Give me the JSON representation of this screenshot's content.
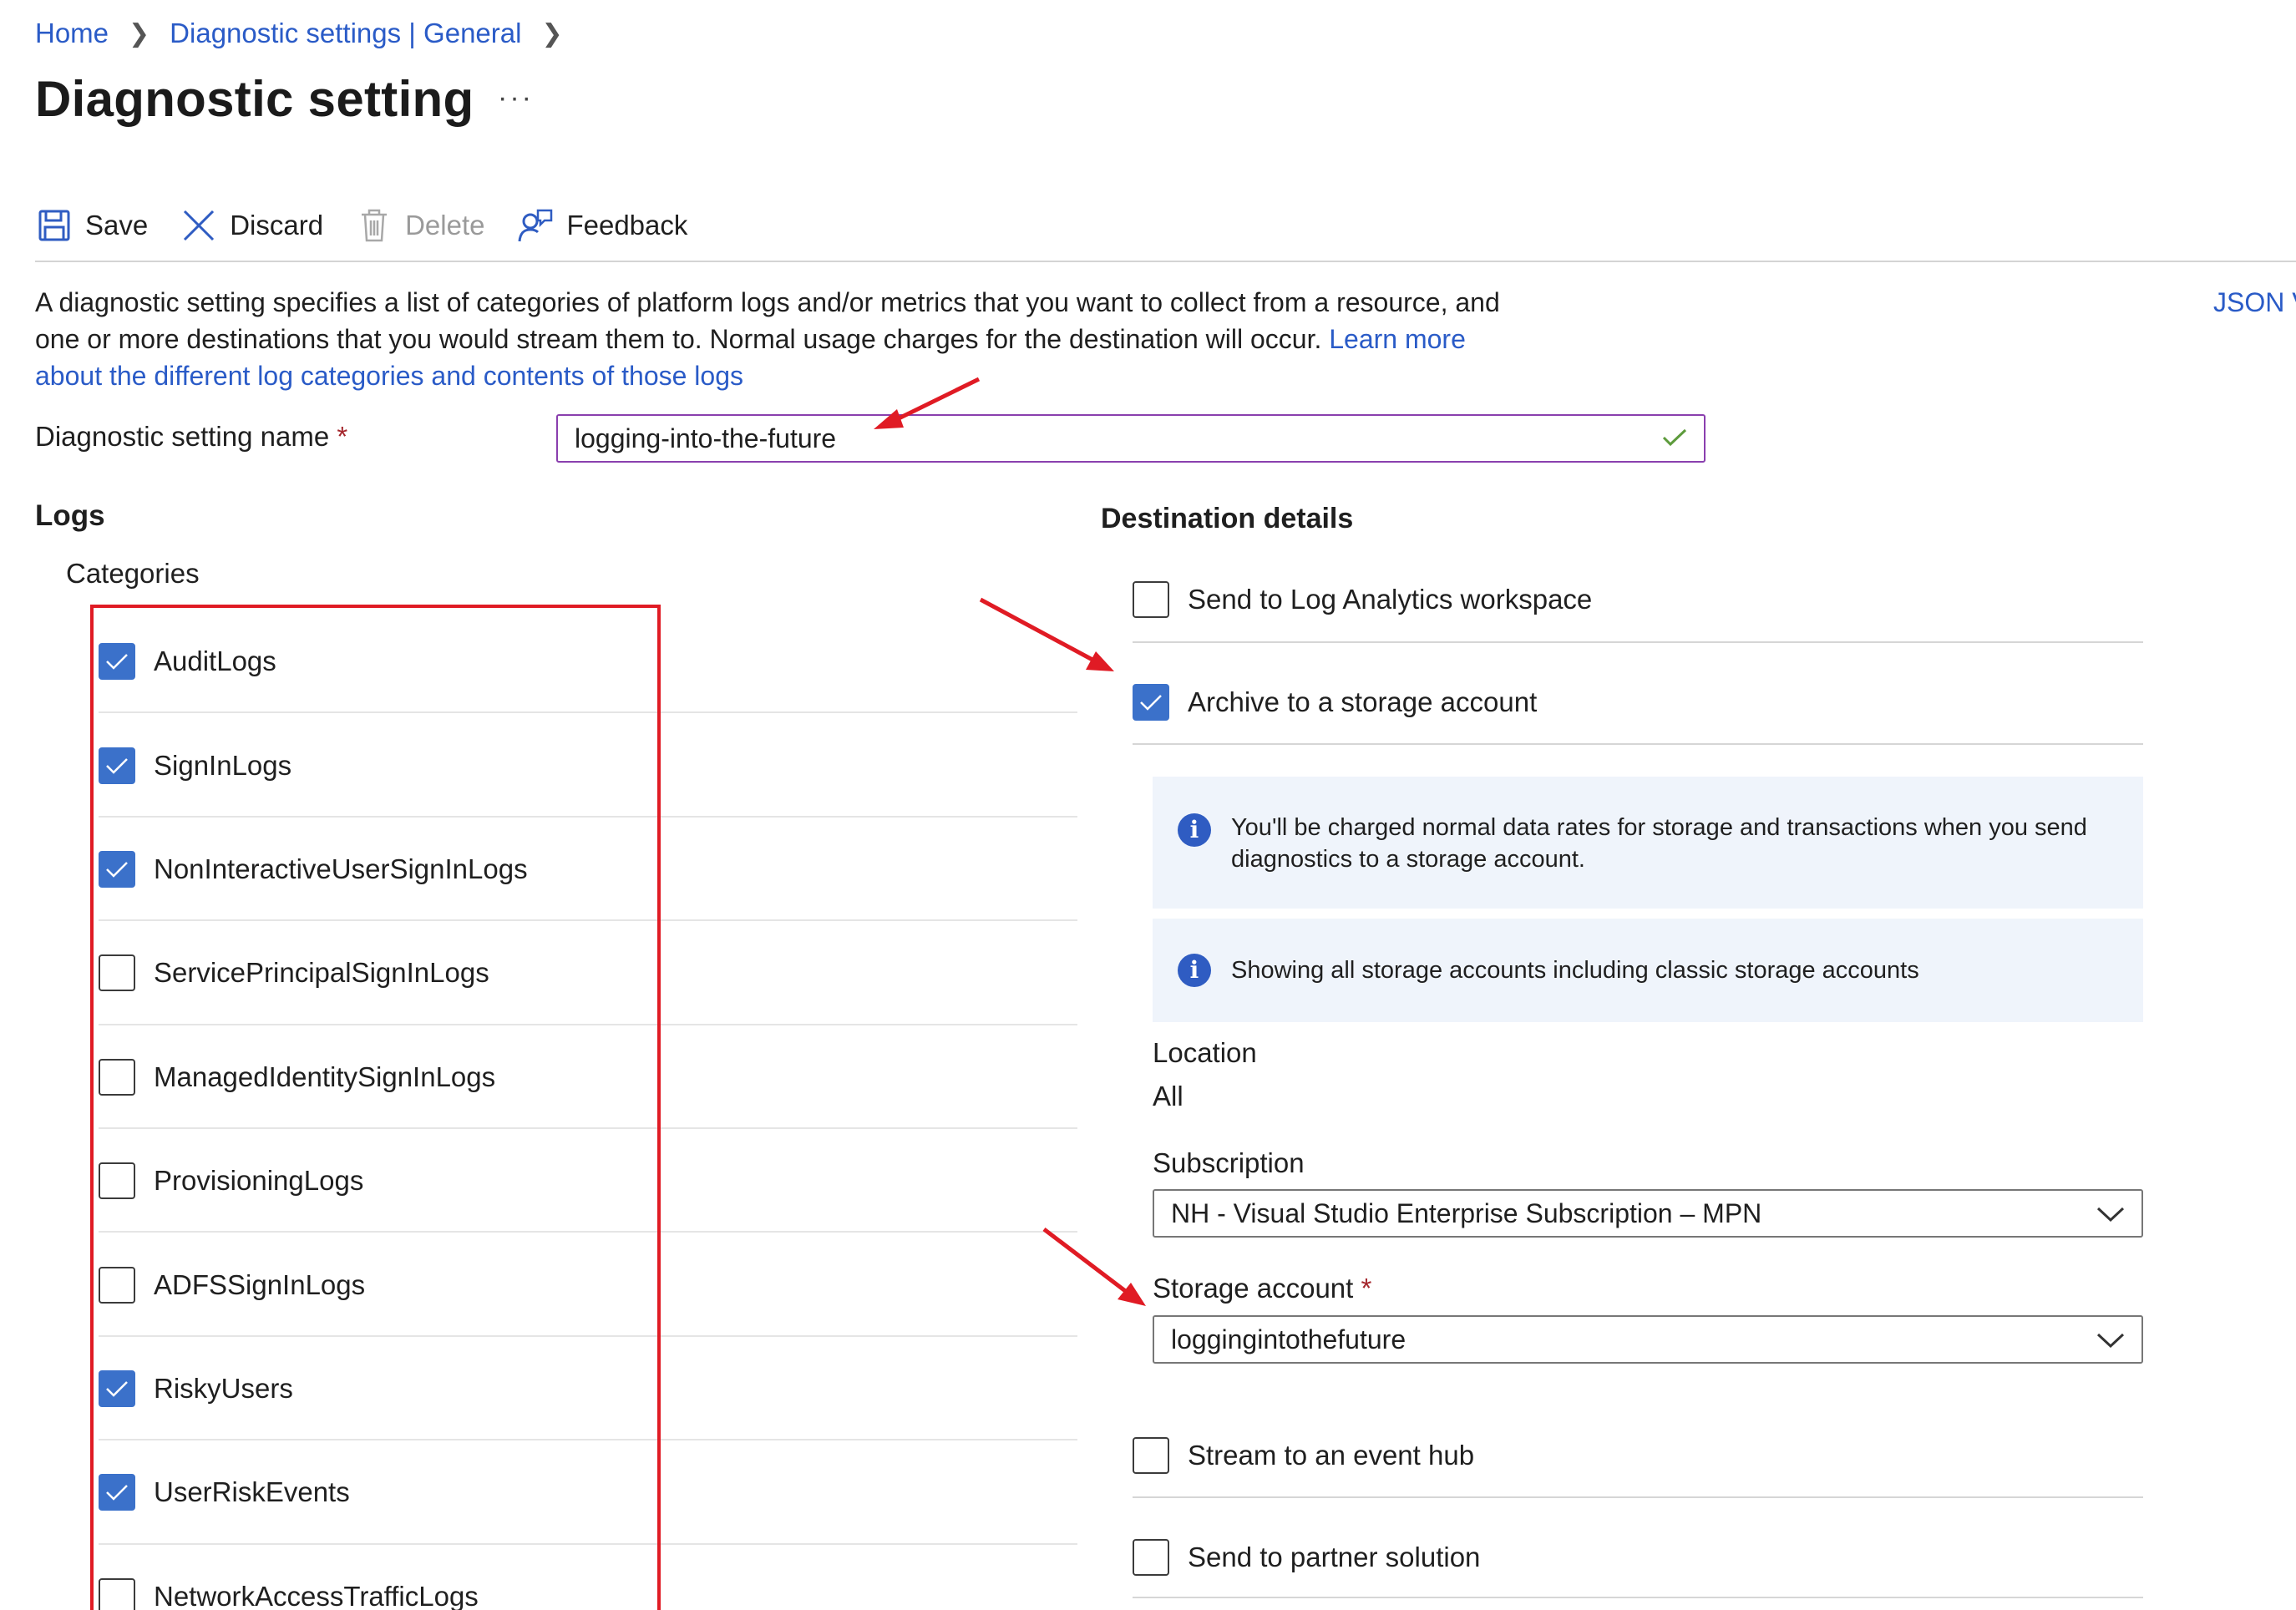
{
  "breadcrumb": {
    "items": [
      "Home",
      "Diagnostic settings | General"
    ]
  },
  "page": {
    "title": "Diagnostic setting",
    "more": "···"
  },
  "toolbar": {
    "save": "Save",
    "discard": "Discard",
    "delete": "Delete",
    "feedback": "Feedback"
  },
  "description": {
    "text": "A diagnostic setting specifies a list of categories of platform logs and/or metrics that you want to collect from a resource, and one or more destinations that you would stream them to. Normal usage charges for the destination will occur.",
    "link": "Learn more about the different log categories and contents of those logs",
    "json_view": "JSON View"
  },
  "name_field": {
    "label": "Diagnostic setting name",
    "required": "*",
    "value": "logging-into-the-future"
  },
  "logs": {
    "heading": "Logs",
    "categories_label": "Categories",
    "categories": [
      {
        "label": "AuditLogs",
        "checked": true
      },
      {
        "label": "SignInLogs",
        "checked": true
      },
      {
        "label": "NonInteractiveUserSignInLogs",
        "checked": true
      },
      {
        "label": "ServicePrincipalSignInLogs",
        "checked": false
      },
      {
        "label": "ManagedIdentitySignInLogs",
        "checked": false
      },
      {
        "label": "ProvisioningLogs",
        "checked": false
      },
      {
        "label": "ADFSSignInLogs",
        "checked": false
      },
      {
        "label": "RiskyUsers",
        "checked": true
      },
      {
        "label": "UserRiskEvents",
        "checked": true
      },
      {
        "label": "NetworkAccessTrafficLogs",
        "checked": false
      }
    ]
  },
  "destination": {
    "heading": "Destination details",
    "log_analytics": {
      "label": "Send to Log Analytics workspace",
      "checked": false
    },
    "storage": {
      "label": "Archive to a storage account",
      "checked": true
    },
    "info_charge": "You'll be charged normal data rates for storage and transactions when you send diagnostics to a storage account.",
    "info_classic": "Showing all storage accounts including classic storage accounts",
    "location_label": "Location",
    "location_value": "All",
    "subscription_label": "Subscription",
    "subscription_value": "NH - Visual Studio Enterprise Subscription – MPN",
    "storage_account_label": "Storage account",
    "storage_account_required": "*",
    "storage_account_value": "loggingintothefuture",
    "event_hub": {
      "label": "Stream to an event hub",
      "checked": false
    },
    "partner": {
      "label": "Send to partner solution",
      "checked": false
    }
  },
  "colors": {
    "link": "#2a5bc7",
    "checkbox_checked": "#3b71ca",
    "annotation_red": "#e01b24",
    "input_focus": "#8a3fae",
    "info_bg": "#eff4fb"
  }
}
